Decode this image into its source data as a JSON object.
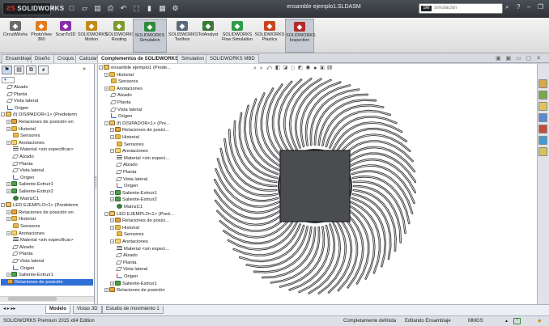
{
  "titlebar": {
    "logo": "SOLIDWORKS",
    "document_title": "ensamble ejemplo1.SLDASM",
    "search_placeholder": "simulacion"
  },
  "ribbon": {
    "buttons": [
      {
        "label": "CircuitWorks",
        "icon": "circuit-icon",
        "color": "#6b6b6b"
      },
      {
        "label": "PhotoView 360",
        "icon": "photoview-icon",
        "color": "#e07b1e"
      },
      {
        "label": "ScanTo3D",
        "icon": "scan-icon",
        "color": "#8a2fa8"
      },
      {
        "label": "SOLIDWORKS Motion",
        "icon": "motion-icon",
        "color": "#c08a1a"
      },
      {
        "label": "SOLIDWORKS Routing",
        "icon": "routing-icon",
        "color": "#7a9a2a"
      },
      {
        "label": "SOLIDWORKS Simulation",
        "icon": "simulation-icon",
        "color": "#2f8a3c",
        "active": true
      },
      {
        "label": "SOLIDWORKS Toolbox",
        "icon": "toolbox-icon",
        "color": "#5a6a7a"
      },
      {
        "label": "TolAnalyst",
        "icon": "tolanalyst-icon",
        "color": "#3a7a3a"
      },
      {
        "label": "SOLIDWORKS Flow Simulation",
        "icon": "flow-icon",
        "color": "#2e9a4a"
      },
      {
        "label": "SOLIDWORKS Plastics",
        "icon": "plastics-icon",
        "color": "#c8451e"
      },
      {
        "label": "SOLIDWORKS Inspection",
        "icon": "inspection-icon",
        "color": "#b02a2a",
        "active": true
      }
    ]
  },
  "tabs": [
    {
      "label": "Ensamblaje"
    },
    {
      "label": "Diseño"
    },
    {
      "label": "Croquis"
    },
    {
      "label": "Calcular"
    },
    {
      "label": "Complementos de SOLIDWORKS",
      "active": true
    },
    {
      "label": "Simulation"
    },
    {
      "label": "SOLIDWORKS MBD"
    }
  ],
  "feature_tree": [
    {
      "label": "Alzado",
      "icon": "plane"
    },
    {
      "label": "Planta",
      "icon": "plane"
    },
    {
      "label": "Vista lateral",
      "icon": "plane"
    },
    {
      "label": "Origen",
      "icon": "origin"
    },
    {
      "label": "(f) DISIPADOR<1> (Predeterm",
      "icon": "part",
      "expand": "-"
    },
    {
      "label": "Relaciones de posición en",
      "icon": "mate",
      "expand": "+",
      "indent": 1
    },
    {
      "label": "Historial",
      "icon": "folder",
      "expand": "+",
      "indent": 1
    },
    {
      "label": "Sensores",
      "icon": "folder",
      "indent": 1
    },
    {
      "label": "Anotaciones",
      "icon": "ann",
      "expand": "+",
      "indent": 1
    },
    {
      "label": "Material <sin especificar>",
      "icon": "mat",
      "indent": 1
    },
    {
      "label": "Alzado",
      "icon": "plane",
      "indent": 1
    },
    {
      "label": "Planta",
      "icon": "plane",
      "indent": 1
    },
    {
      "label": "Vista lateral",
      "icon": "plane",
      "indent": 1
    },
    {
      "label": "Origen",
      "icon": "origin",
      "indent": 1
    },
    {
      "label": "Saliente-Extruir1",
      "icon": "feat",
      "expand": "+",
      "indent": 1
    },
    {
      "label": "Saliente-Extruir2",
      "icon": "feat",
      "expand": "+",
      "indent": 1
    },
    {
      "label": "MatrizC1",
      "icon": "pat",
      "indent": 1
    },
    {
      "label": "LED EJEMPLO<1> (Predeterm",
      "icon": "part",
      "expand": "-"
    },
    {
      "label": "Relaciones de posición en",
      "icon": "mate",
      "expand": "+",
      "indent": 1
    },
    {
      "label": "Historial",
      "icon": "folder",
      "expand": "+",
      "indent": 1
    },
    {
      "label": "Sensores",
      "icon": "folder",
      "indent": 1
    },
    {
      "label": "Anotaciones",
      "icon": "ann",
      "expand": "+",
      "indent": 1
    },
    {
      "label": "Material <sin especificar>",
      "icon": "mat",
      "indent": 1
    },
    {
      "label": "Alzado",
      "icon": "plane",
      "indent": 1
    },
    {
      "label": "Planta",
      "icon": "plane",
      "indent": 1
    },
    {
      "label": "Vista lateral",
      "icon": "plane",
      "indent": 1
    },
    {
      "label": "Origen",
      "icon": "origin",
      "indent": 1
    },
    {
      "label": "Saliente-Extruir1",
      "icon": "feat",
      "expand": "+",
      "indent": 1
    },
    {
      "label": "Relaciones de posición",
      "icon": "mate",
      "selected": true
    }
  ],
  "flyout_tree": [
    {
      "label": "ensamble ejemplo1 (Prede...",
      "icon": "part",
      "expand": "-"
    },
    {
      "label": "Historial",
      "icon": "folder",
      "expand": "+",
      "indent": 1
    },
    {
      "label": "Sensores",
      "icon": "folder",
      "indent": 1
    },
    {
      "label": "Anotaciones",
      "icon": "ann",
      "expand": "+",
      "indent": 1
    },
    {
      "label": "Alzado",
      "icon": "plane",
      "indent": 1
    },
    {
      "label": "Planta",
      "icon": "plane",
      "indent": 1
    },
    {
      "label": "Vista lateral",
      "icon": "plane",
      "indent": 1
    },
    {
      "label": "Origen",
      "icon": "origin",
      "indent": 1
    },
    {
      "label": "(f) DISIPADOR<1> (Pre...",
      "icon": "part",
      "expand": "-",
      "indent": 1
    },
    {
      "label": "Relaciones de posici...",
      "icon": "mate",
      "expand": "+",
      "indent": 2
    },
    {
      "label": "Historial",
      "icon": "folder",
      "expand": "+",
      "indent": 2
    },
    {
      "label": "Sensores",
      "icon": "folder",
      "indent": 2
    },
    {
      "label": "Anotaciones",
      "icon": "ann",
      "expand": "+",
      "indent": 2
    },
    {
      "label": "Material <sin especi...",
      "icon": "mat",
      "indent": 2
    },
    {
      "label": "Alzado",
      "icon": "plane",
      "indent": 2
    },
    {
      "label": "Planta",
      "icon": "plane",
      "indent": 2
    },
    {
      "label": "Vista lateral",
      "icon": "plane",
      "indent": 2
    },
    {
      "label": "Origen",
      "icon": "origin",
      "indent": 2
    },
    {
      "label": "Saliente-Extruir1",
      "icon": "feat",
      "expand": "+",
      "indent": 2
    },
    {
      "label": "Saliente-Extruir2",
      "icon": "feat",
      "expand": "+",
      "indent": 2
    },
    {
      "label": "MatrizC1",
      "icon": "pat",
      "indent": 2
    },
    {
      "label": "LED EJEMPLO<1> (Pred...",
      "icon": "part",
      "expand": "-",
      "indent": 1
    },
    {
      "label": "Relaciones de posici...",
      "icon": "mate",
      "expand": "+",
      "indent": 2
    },
    {
      "label": "Historial",
      "icon": "folder",
      "expand": "+",
      "indent": 2
    },
    {
      "label": "Sensores",
      "icon": "folder",
      "indent": 2
    },
    {
      "label": "Anotaciones",
      "icon": "ann",
      "expand": "+",
      "indent": 2
    },
    {
      "label": "Material <sin especi...",
      "icon": "mat",
      "indent": 2
    },
    {
      "label": "Alzado",
      "icon": "plane",
      "indent": 2
    },
    {
      "label": "Planta",
      "icon": "plane",
      "indent": 2
    },
    {
      "label": "Vista lateral",
      "icon": "plane",
      "indent": 2
    },
    {
      "label": "Origen",
      "icon": "origin",
      "indent": 2
    },
    {
      "label": "Saliente-Extruir1",
      "icon": "feat",
      "expand": "+",
      "indent": 2
    },
    {
      "label": "Relaciones de posición",
      "icon": "mate",
      "expand": "+",
      "indent": 1
    }
  ],
  "bottom_tabs": [
    {
      "label": "Modelo",
      "active": true
    },
    {
      "label": "Vistas 3D"
    },
    {
      "label": "Estudio de movimiento 1"
    }
  ],
  "statusbar": {
    "edition": "SOLIDWORKS Premium 2015 x64 Edition",
    "status": "Completamente definida",
    "mode": "Editando Ensamblaje",
    "units": "MMGS"
  },
  "colors": {
    "accent": "#2f6fd6",
    "heatsink": "#3d3f42",
    "heatsink_core": "#4a4c50"
  }
}
